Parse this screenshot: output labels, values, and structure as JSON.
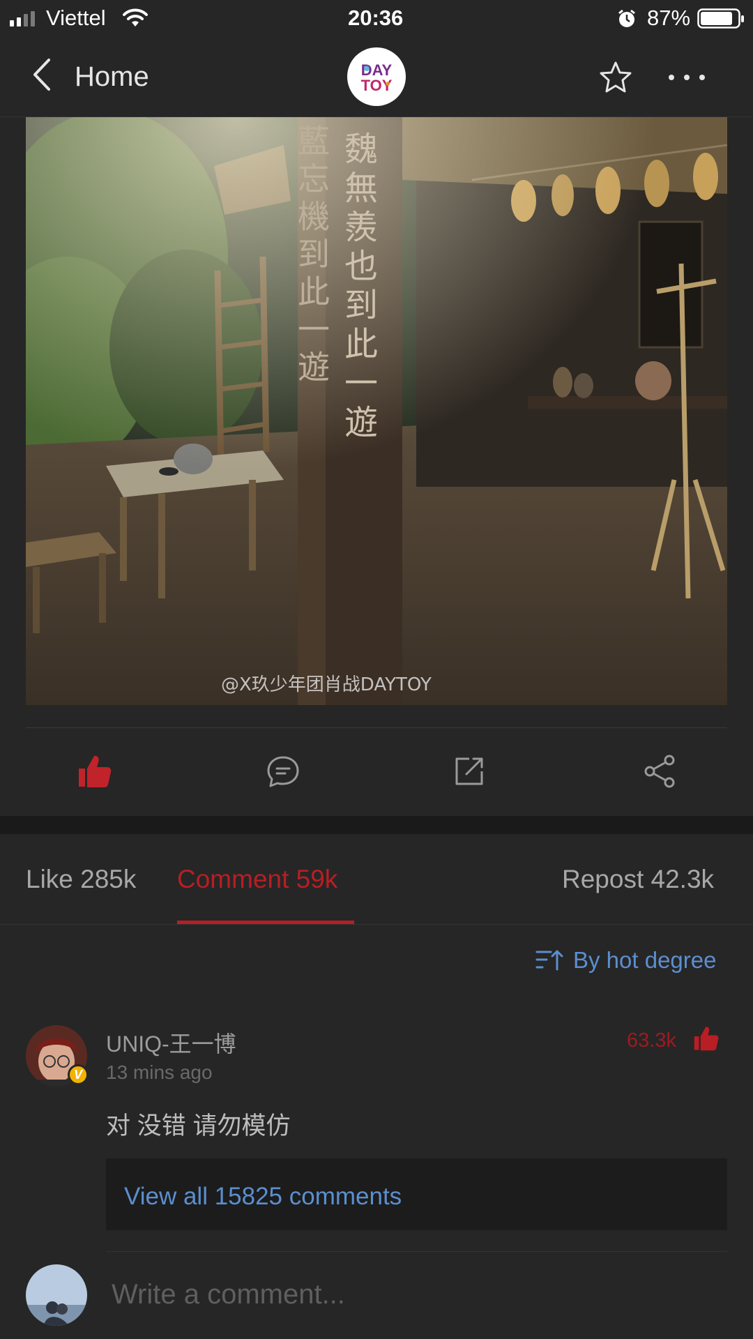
{
  "status_bar": {
    "carrier": "Viettel",
    "time": "20:36",
    "battery": "87%"
  },
  "nav": {
    "back_icon": "chevron-left-icon",
    "title": "Home",
    "logo_text": [
      "DAY",
      "TOY"
    ],
    "star_icon": "star-icon",
    "more_icon": "more-horizontal-icon"
  },
  "photo": {
    "watermark": "@X玖少年团肖战DAYTOY",
    "post_right_inscription": "魏無羨也到此一遊",
    "post_left_inscription": "藍忘機到此一遊"
  },
  "actions": [
    "thumb-up-icon",
    "comment-icon",
    "forward-icon",
    "share-icon"
  ],
  "tabs": {
    "like": "Like 285k",
    "comment": "Comment 59k",
    "repost": "Repost 42.3k"
  },
  "sort": {
    "label": "By hot degree",
    "icon": "sort-icon"
  },
  "comment": {
    "user": "UNIQ-王一博",
    "time": "13 mins ago",
    "likes": "63.3k",
    "badge": "V",
    "text": "对 没错 请勿模仿",
    "view_all": "View all 15825 comments"
  },
  "compose": {
    "placeholder": "Write a comment..."
  },
  "colors": {
    "accent_red": "#b81e24",
    "link_blue": "#5b8fcf",
    "background": "#262626"
  }
}
